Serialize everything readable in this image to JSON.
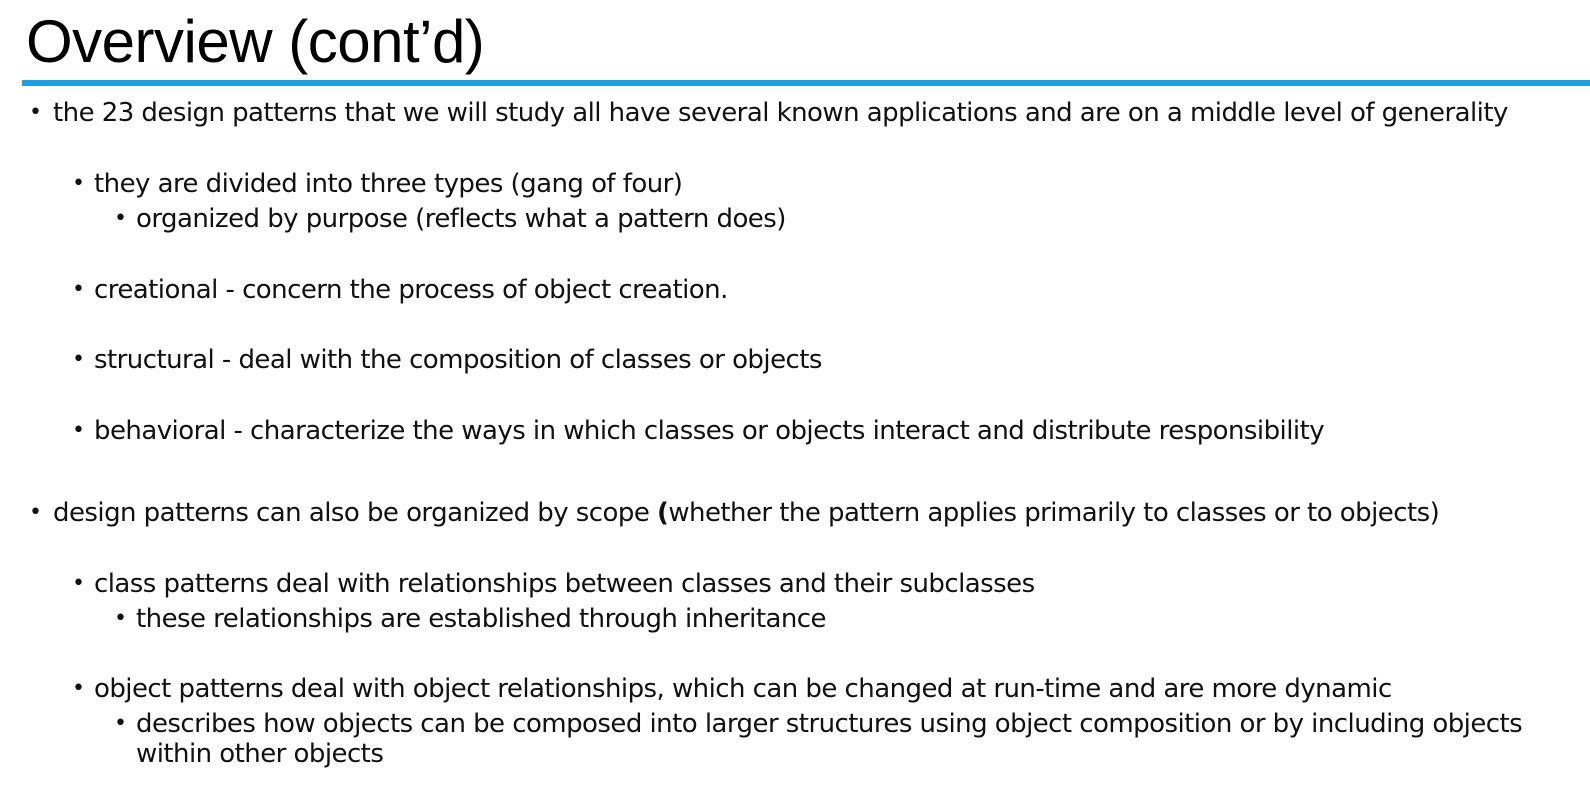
{
  "slide": {
    "title": "Overview (cont’d)",
    "accent_color": "#1aa0e3",
    "bullet_icon": "bullet-dot"
  },
  "bullets": [
    {
      "level": 1,
      "text": "the 23 design patterns that we will study all have several known applications and are on a middle level of generality"
    },
    {
      "level": 2,
      "text": "they are divided into three types (gang of four)"
    },
    {
      "level": 3,
      "text": "organized by purpose (reflects what a pattern does)"
    },
    {
      "level": 2,
      "text": "creational - concern the process of object creation."
    },
    {
      "level": 2,
      "text": "structural - deal with the composition of classes or objects"
    },
    {
      "level": 2,
      "text": "behavioral - characterize the ways in which classes or objects interact and distribute responsibility"
    },
    {
      "level": 1,
      "text_before": "design patterns can also be organized by scope ",
      "text_bold": "(",
      "text_after": "whether the pattern applies primarily to classes or to objects)"
    },
    {
      "level": 2,
      "text": "class patterns deal with relationships between classes and their subclasses"
    },
    {
      "level": 3,
      "text": "these relationships are established through inheritance"
    },
    {
      "level": 2,
      "text": "object patterns deal with object relationships, which can be changed at run-time and are more dynamic"
    },
    {
      "level": 3,
      "text": "describes how objects can be composed into larger structures using object composition or by including objects within other objects"
    }
  ]
}
